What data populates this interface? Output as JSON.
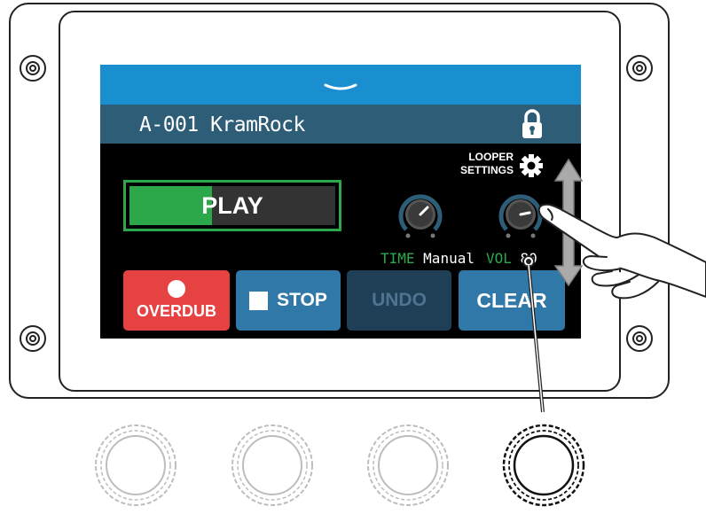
{
  "screen": {
    "patch_name": "A-001 KramRock",
    "looper_settings_line1": "LOOPER",
    "looper_settings_line2": "SETTINGS",
    "play_label": "PLAY",
    "play_progress": 0.4,
    "knobs": [
      {
        "param": "TIME",
        "value": "Manual"
      },
      {
        "param": "VOL",
        "value": "80"
      }
    ],
    "buttons": {
      "overdub": "OVERDUB",
      "stop": "STOP",
      "undo": "UNDO",
      "clear": "CLEAR"
    }
  },
  "colors": {
    "header_blue": "#1a8fcf",
    "title_bar": "#2e5d78",
    "play_green": "#2ca84a",
    "overdub_red": "#e64242",
    "button_blue": "#2f78a8",
    "undo_disabled": "#1f3f57"
  },
  "icons": [
    "chevron-down-icon",
    "lock-icon",
    "gear-icon",
    "record-icon",
    "stop-icon",
    "screw-icon",
    "hand-icon",
    "scroll-arrow-icon"
  ],
  "footswitches": 4,
  "highlighted_footswitch": 4
}
